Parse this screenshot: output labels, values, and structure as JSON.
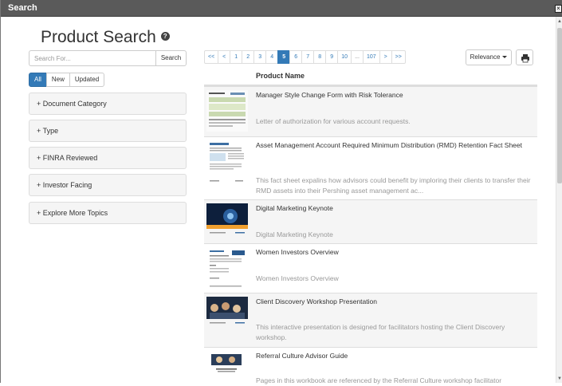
{
  "window": {
    "title": "Search"
  },
  "page": {
    "title": "Product Search"
  },
  "search": {
    "placeholder": "Search For...",
    "value": "",
    "button_label": "Search"
  },
  "filters": [
    {
      "label": "All",
      "active": true
    },
    {
      "label": "New",
      "active": false
    },
    {
      "label": "Updated",
      "active": false
    }
  ],
  "facets": [
    "+ Document Category",
    "+ Type",
    "+ FINRA Reviewed",
    "+ Investor Facing",
    "+ Explore More Topics"
  ],
  "pagination": [
    "<<",
    "<",
    "1",
    "2",
    "3",
    "4",
    "5",
    "6",
    "7",
    "8",
    "9",
    "10",
    "...",
    "107",
    ">",
    ">>"
  ],
  "pagination_active": "5",
  "sort": {
    "label": "Relevance"
  },
  "table": {
    "header": "Product Name"
  },
  "results": [
    {
      "title": "Manager Style Change Form with Risk Tolerance",
      "description": "Letter of authorization for various account requests.",
      "thumb": "form-doc"
    },
    {
      "title": "Asset Management Account Required Minimum Distribution (RMD) Retention Fact Sheet",
      "description": "This fact sheet expalins how advisors could benefit by imploring their clients to transfer their RMD assets into their Pershing asset management ac...",
      "thumb": "fact-sheet"
    },
    {
      "title": "Digital Marketing Keynote",
      "description": "Digital Marketing Keynote",
      "thumb": "keynote-slide"
    },
    {
      "title": "Women Investors Overview",
      "description": "Women Investors Overview",
      "thumb": "overview-doc"
    },
    {
      "title": "Client Discovery Workshop Presentation",
      "description": "This interactive presentation is designed for facilitators hosting the Client Discovery workshop.",
      "thumb": "workshop-slide"
    },
    {
      "title": "Referral Culture Advisor Guide",
      "description": "Pages in this workbook are referenced by the Referral Culture workshop facilitator",
      "thumb": "guide-cover"
    }
  ],
  "colors": {
    "accent": "#337ab7",
    "titlebar": "#5a5a5a",
    "row_alt": "#f5f5f5"
  }
}
